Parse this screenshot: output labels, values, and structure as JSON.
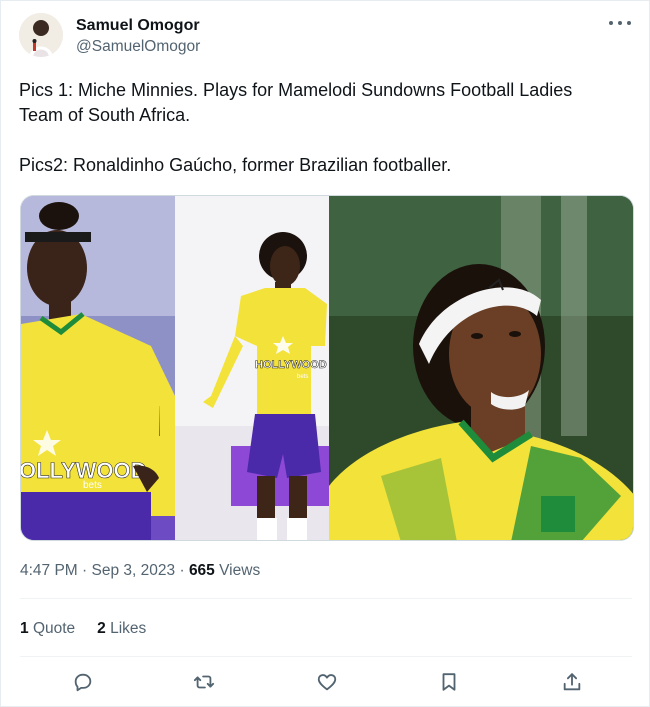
{
  "author": {
    "display_name": "Samuel Omogor",
    "handle": "@SamuelOmogor"
  },
  "tweet": {
    "text": "Pics 1: Miche Minnies. Plays for Mamelodi Sundowns Football Ladies Team of South Africa.\n\nPics2: Ronaldinho Gaúcho, former Brazilian footballer."
  },
  "media": {
    "jersey_text_1": "OLLYWOOD",
    "jersey_text_1_sub": "bets",
    "jersey_text_2": "HOLLYWOOD",
    "jersey_text_2_sub": "bets",
    "colors": {
      "jersey_yellow": "#f2e23a",
      "jersey_green": "#1e8c3a",
      "shorts_purple": "#4a2aa8",
      "pitch_green": "#2f4a2a"
    }
  },
  "meta": {
    "time": "4:47 PM",
    "separator": "·",
    "date": "Sep 3, 2023",
    "separator2": "·",
    "views_count": "665",
    "views_label": "Views"
  },
  "stats": {
    "quotes_count": "1",
    "quotes_label": "Quote",
    "likes_count": "2",
    "likes_label": "Likes"
  },
  "actions": {
    "reply_icon": "reply-icon",
    "retweet_icon": "retweet-icon",
    "like_icon": "heart-icon",
    "bookmark_icon": "bookmark-icon",
    "share_icon": "share-icon"
  }
}
